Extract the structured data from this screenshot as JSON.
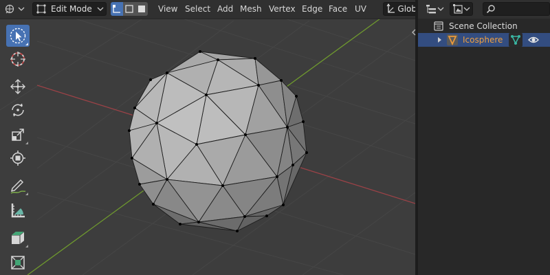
{
  "header": {
    "mode_label": "Edit Mode",
    "menus": [
      "View",
      "Select",
      "Add",
      "Mesh",
      "Vertex",
      "Edge",
      "Face",
      "UV"
    ],
    "orientation_label": "Glob"
  },
  "toolbar": {
    "tools": [
      "select-box",
      "cursor",
      "move",
      "rotate",
      "scale",
      "transform",
      "annotate",
      "measure",
      "add-cube",
      "extrude-region"
    ],
    "active_tool": "select-box"
  },
  "outliner": {
    "scene_collection_label": "Scene Collection",
    "object_label": "Icosphere",
    "object_color": "#e8a33d"
  },
  "colors": {
    "x_axis": "#9b4247",
    "y_axis": "#6f9a2e",
    "accent": "#4772b3"
  }
}
